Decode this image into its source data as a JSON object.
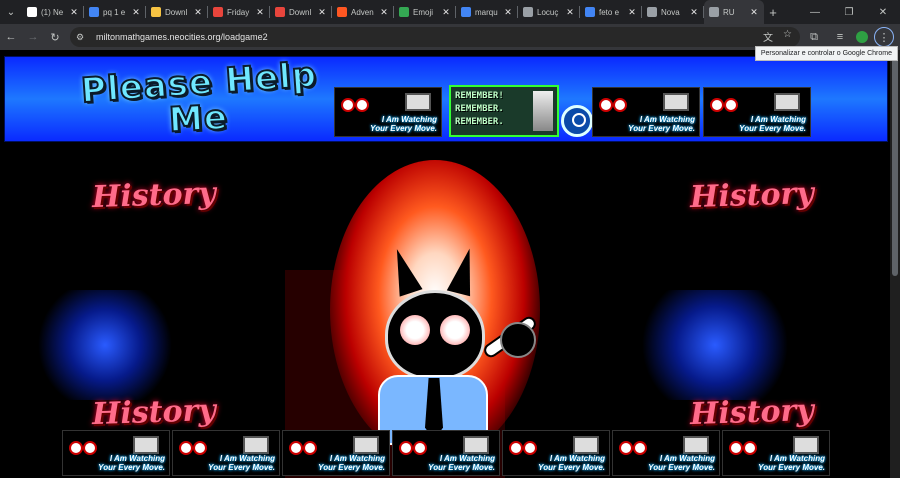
{
  "browser": {
    "tabs": [
      {
        "title": "(1) Ne",
        "color": "#ffffff",
        "icon": "bolt-icon"
      },
      {
        "title": "pq 1 e",
        "color": "#4285f4",
        "icon": "google-icon"
      },
      {
        "title": "Downl",
        "color": "#f6c343",
        "icon": "moon-icon"
      },
      {
        "title": "Friday",
        "color": "#e8453c",
        "icon": "calendar-icon"
      },
      {
        "title": "Downl",
        "color": "#e8453c",
        "icon": "calendar-icon"
      },
      {
        "title": "Adven",
        "color": "#ff5722",
        "icon": "star-icon"
      },
      {
        "title": "Emoji",
        "color": "#34a853",
        "icon": "tree-icon"
      },
      {
        "title": "marqu",
        "color": "#4285f4",
        "icon": "google-icon"
      },
      {
        "title": "Locuç",
        "color": "#9aa0a6",
        "icon": "globe-icon"
      },
      {
        "title": "feto e",
        "color": "#4285f4",
        "icon": "google-icon"
      },
      {
        "title": "Nova",
        "color": "#9aa0a6",
        "icon": "chrome-icon"
      },
      {
        "title": "RU",
        "color": "#9aa0a6",
        "icon": "neocities-icon",
        "active": true
      }
    ],
    "url": "miltonmathgames.neocities.org/loadgame2",
    "tooltip": "Personalizar e controlar o Google Chrome"
  },
  "banner": {
    "title_line1": "Please Help",
    "title_line2": "Me",
    "watch_line1": "I Am Watching",
    "watch_line2": "Your Every Move.",
    "remember_lines": [
      "REMEMBER!",
      "REMEMBER.",
      "REMEMBER."
    ]
  },
  "side_panels": {
    "history_text": "History"
  }
}
